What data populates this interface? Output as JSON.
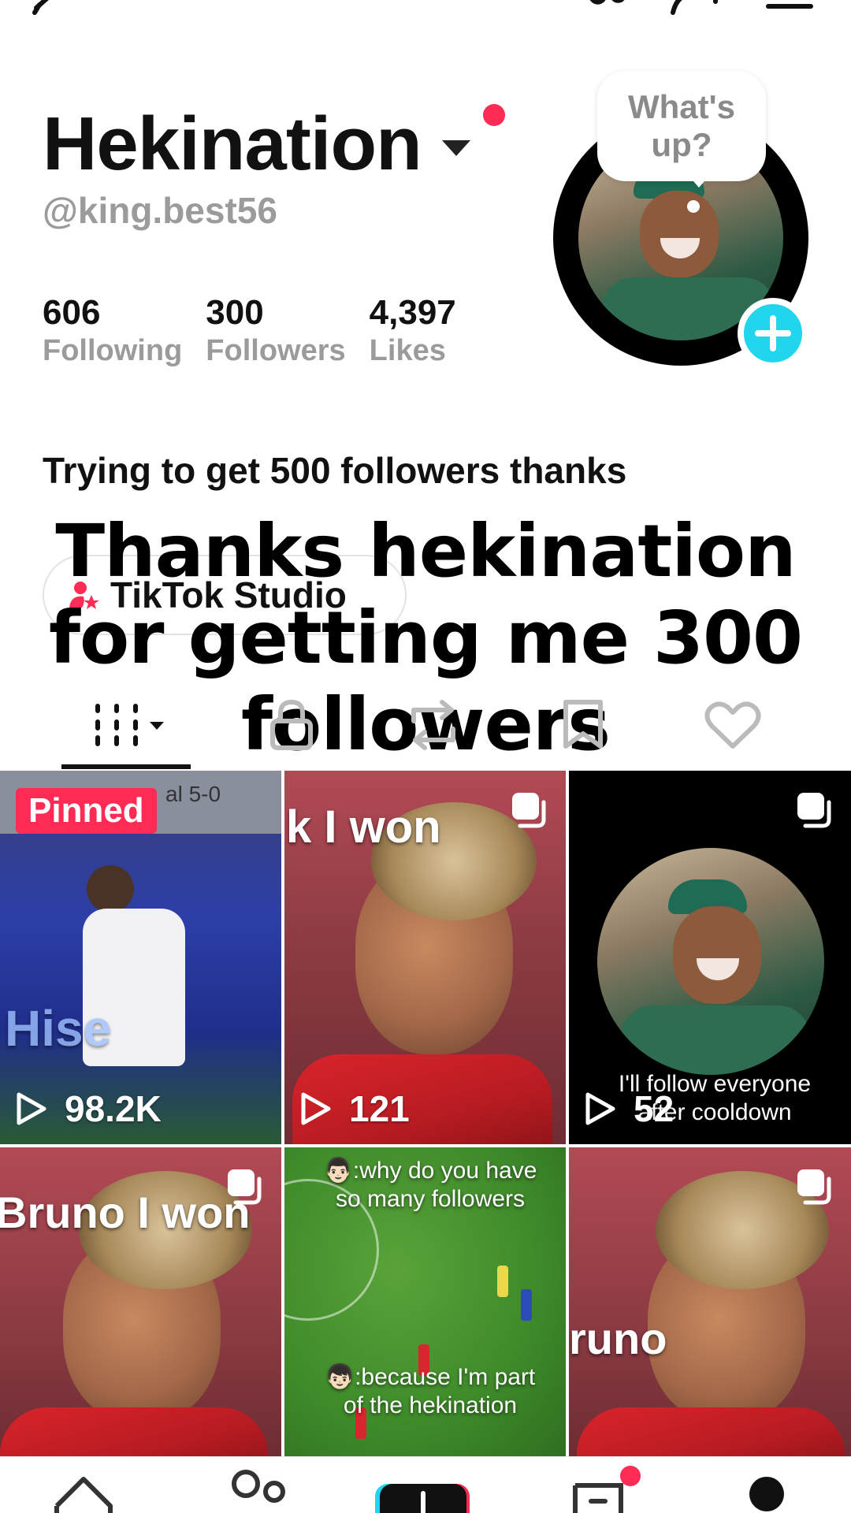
{
  "profile": {
    "display_name": "Hekination",
    "handle": "@king.best56",
    "bio": "Trying to get 500 followers thanks",
    "bubble_text": "What's up?",
    "stats": [
      {
        "value": "606",
        "label": "Following"
      },
      {
        "value": "300",
        "label": "Followers"
      },
      {
        "value": "4,397",
        "label": "Likes"
      }
    ]
  },
  "studio_button": {
    "label": "TikTok Studio"
  },
  "overlay_caption": "Thanks hekination for getting me 300 followers",
  "tabs": [
    {
      "name": "videos",
      "icon": "grid-icon",
      "active": true
    },
    {
      "name": "private",
      "icon": "lock-icon"
    },
    {
      "name": "reposts",
      "icon": "repost-icon"
    },
    {
      "name": "favorites",
      "icon": "bookmark-icon"
    },
    {
      "name": "liked",
      "icon": "heart-icon"
    }
  ],
  "videos": [
    {
      "pinned_label": "Pinned",
      "top_text": "al 5-0",
      "views": "98.2K",
      "scene_text": "Hise"
    },
    {
      "top_text": "k I won",
      "views": "121"
    },
    {
      "caption": "I'll follow everyone after cooldown",
      "views": "52"
    },
    {
      "top_text": "Bruno I won"
    },
    {
      "caption_top": "👨🏻:why do you have so many followers",
      "caption_bottom": "👦🏻:because I'm part of the hekination"
    },
    {
      "top_text": "runo"
    }
  ],
  "colors": {
    "accent": "#fe2c55",
    "cyan": "#20d5ec",
    "muted_text": "#9b9b9b"
  }
}
